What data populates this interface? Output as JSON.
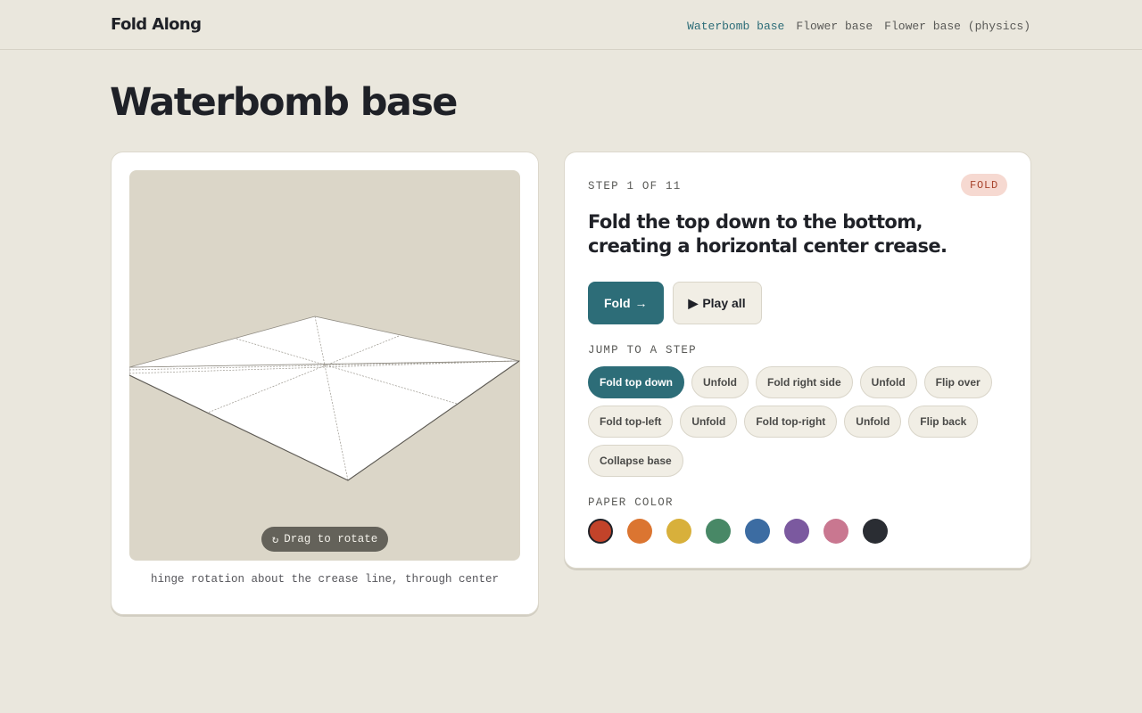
{
  "header": {
    "brand": "Fold Along",
    "nav": [
      {
        "label": "Waterbomb base",
        "active": true
      },
      {
        "label": "Flower base",
        "active": false
      },
      {
        "label": "Flower base (physics)",
        "active": false
      }
    ]
  },
  "page": {
    "title": "Waterbomb base"
  },
  "viewer": {
    "drag_icon": "rotate-icon",
    "drag_glyph": "↻",
    "drag_label": "Drag to rotate",
    "caption": "hinge rotation about the crease line, through center"
  },
  "step": {
    "label": "STEP 1 OF 11",
    "badge": "FOLD",
    "instruction": "Fold the top down to the bottom, creating a horizontal center crease.",
    "primary_button": "Fold",
    "primary_icon": "arrow-right-icon",
    "primary_glyph": "→",
    "secondary_button": "Play all",
    "secondary_icon": "play-icon",
    "secondary_glyph": "▶"
  },
  "jump": {
    "label": "JUMP TO A STEP",
    "steps": [
      {
        "label": "Fold top down",
        "active": true
      },
      {
        "label": "Unfold",
        "active": false
      },
      {
        "label": "Fold right side",
        "active": false
      },
      {
        "label": "Unfold",
        "active": false
      },
      {
        "label": "Flip over",
        "active": false
      },
      {
        "label": "Fold top-left",
        "active": false
      },
      {
        "label": "Unfold",
        "active": false
      },
      {
        "label": "Fold top-right",
        "active": false
      },
      {
        "label": "Unfold",
        "active": false
      },
      {
        "label": "Flip back",
        "active": false
      },
      {
        "label": "Collapse base",
        "active": false
      }
    ]
  },
  "paper_color": {
    "label": "PAPER COLOR",
    "swatches": [
      {
        "color": "#c2432a",
        "selected": true
      },
      {
        "color": "#db7531",
        "selected": false
      },
      {
        "color": "#d8b03b",
        "selected": false
      },
      {
        "color": "#488866",
        "selected": false
      },
      {
        "color": "#3c6ca2",
        "selected": false
      },
      {
        "color": "#7b599f",
        "selected": false
      },
      {
        "color": "#c97790",
        "selected": false
      },
      {
        "color": "#2a2d33",
        "selected": false
      }
    ]
  },
  "colors": {
    "accent": "#2d6d78",
    "badge_bg": "#f6d9d1",
    "badge_text": "#a8432c",
    "background": "#eae7dd",
    "viewport_bg": "#dbd6c8"
  }
}
